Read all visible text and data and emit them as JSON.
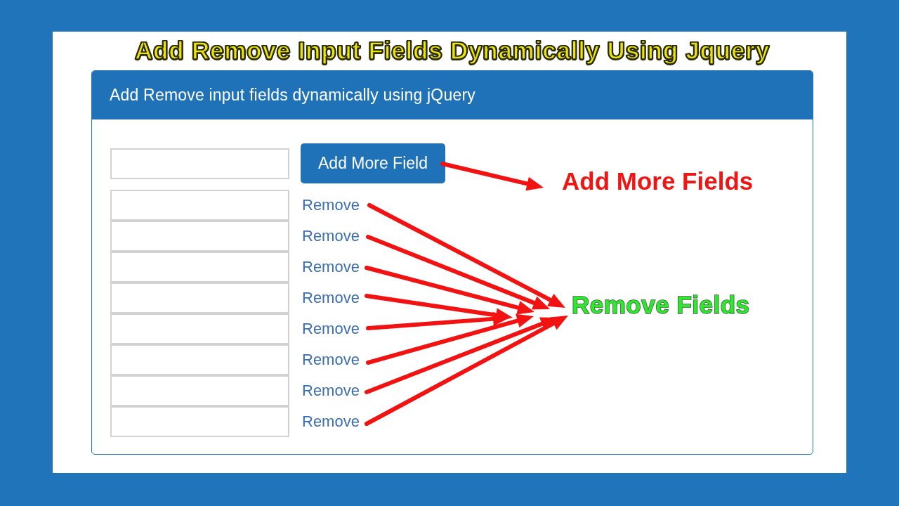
{
  "page_title": "Add Remove Input Fields Dynamically Using Jquery",
  "panel": {
    "heading": "Add Remove input fields dynamically using jQuery"
  },
  "form": {
    "add_button": "Add More Field",
    "rows": [
      {
        "remove_link": "Remove"
      },
      {
        "remove_link": "Remove"
      },
      {
        "remove_link": "Remove"
      },
      {
        "remove_link": "Remove"
      },
      {
        "remove_link": "Remove"
      },
      {
        "remove_link": "Remove"
      },
      {
        "remove_link": "Remove"
      },
      {
        "remove_link": "Remove"
      }
    ]
  },
  "annotations": [
    {
      "kind": "add",
      "text": "Add More Fields"
    },
    {
      "kind": "remove",
      "text": "Remove Fields"
    }
  ]
}
